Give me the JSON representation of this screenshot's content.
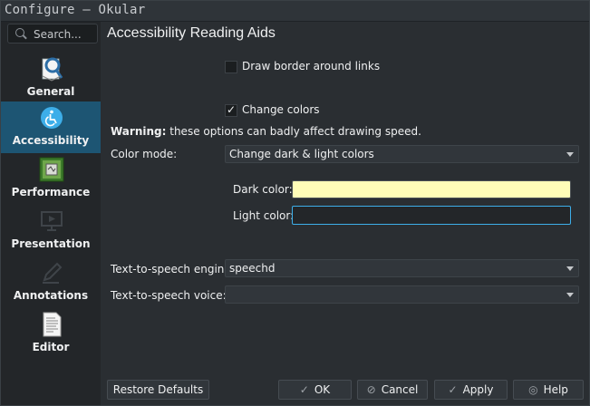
{
  "window": {
    "title": "Configure — Okular"
  },
  "sidebar": {
    "search_placeholder": "Search...",
    "items": [
      {
        "label": "General",
        "icon": "okular-app-icon"
      },
      {
        "label": "Accessibility",
        "icon": "accessibility-icon"
      },
      {
        "label": "Performance",
        "icon": "chip-icon"
      },
      {
        "label": "Presentation",
        "icon": "presentation-screen-icon"
      },
      {
        "label": "Annotations",
        "icon": "pen-icon"
      },
      {
        "label": "Editor",
        "icon": "document-text-icon"
      }
    ],
    "active": "Accessibility"
  },
  "page": {
    "title": "Accessibility Reading Aids",
    "draw_border_label": "Draw border around links",
    "draw_border_checked": false,
    "change_colors_label": "Change colors",
    "change_colors_checked": true,
    "warning_bold": "Warning:",
    "warning_text": "these options can badly affect drawing speed.",
    "color_mode_label": "Color mode:",
    "color_mode_value": "Change dark & light colors",
    "dark_color_label": "Dark color:",
    "dark_color_value": "#fffdb8",
    "light_color_label": "Light color:",
    "light_color_value": "#232629",
    "tts_engine_label": "Text-to-speech engine:",
    "tts_engine_value": "speechd",
    "tts_voice_label": "Text-to-speech voice:",
    "tts_voice_value": ""
  },
  "buttons": {
    "restore": "Restore Defaults",
    "ok": "OK",
    "cancel": "Cancel",
    "apply": "Apply",
    "help": "Help"
  },
  "colors": {
    "accent": "#1d5573",
    "focus": "#3daee9",
    "background": "#2a2e32"
  }
}
